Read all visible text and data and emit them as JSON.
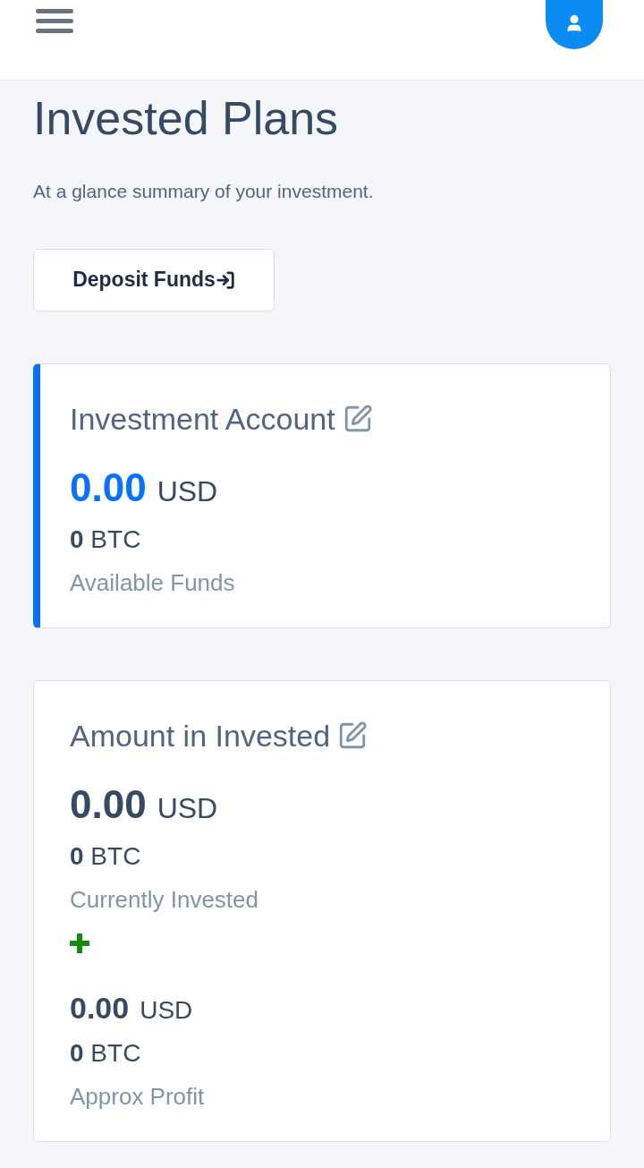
{
  "page": {
    "title": "Invested Plans",
    "subtitle": "At a glance summary of your investment."
  },
  "deposit_button": {
    "label": "Deposit Funds"
  },
  "cards": [
    {
      "title": "Investment Account",
      "accent": true,
      "entries": [
        {
          "kind": "primary",
          "amount": "0.00",
          "currency": "USD",
          "btc": "**0** BTC",
          "label": "Available Funds"
        }
      ]
    },
    {
      "title": "Amount in Invested",
      "accent": false,
      "entries": [
        {
          "kind": "primary",
          "amount": "0.00",
          "currency": "USD",
          "btc": "**0** BTC",
          "label": "Currently Invested"
        },
        {
          "kind": "secondary",
          "amount": "0.00",
          "currency": "USD",
          "btc": "**0** BTC",
          "label": "Approx Profit"
        }
      ]
    }
  ]
}
